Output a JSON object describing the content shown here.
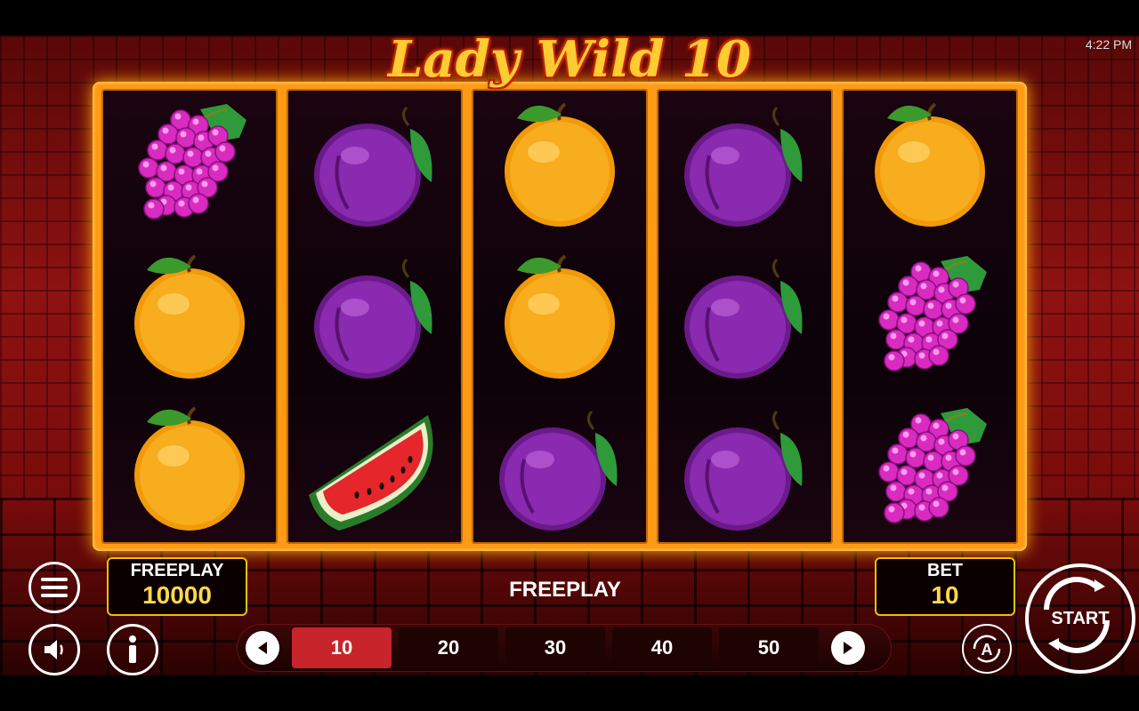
{
  "status_bar": {
    "time": "4:22 PM"
  },
  "game": {
    "title": "Lady Wild 10"
  },
  "reels": [
    [
      "grapes",
      "orange",
      "orange"
    ],
    [
      "plum",
      "plum",
      "watermelon"
    ],
    [
      "orange",
      "orange",
      "plum"
    ],
    [
      "plum",
      "plum",
      "plum"
    ],
    [
      "orange",
      "grapes",
      "grapes"
    ]
  ],
  "balance": {
    "label": "FREEPLAY",
    "value": "10000"
  },
  "message": "FREEPLAY",
  "bet": {
    "label": "BET",
    "value": "10"
  },
  "bet_options": [
    "10",
    "20",
    "30",
    "40",
    "50"
  ],
  "bet_selected_index": 0,
  "controls": {
    "start_label": "START",
    "auto_label": "A"
  },
  "colors": {
    "accent": "#ffcc33",
    "selected_bet": "#c8242c",
    "frame": "#ff9a14"
  }
}
